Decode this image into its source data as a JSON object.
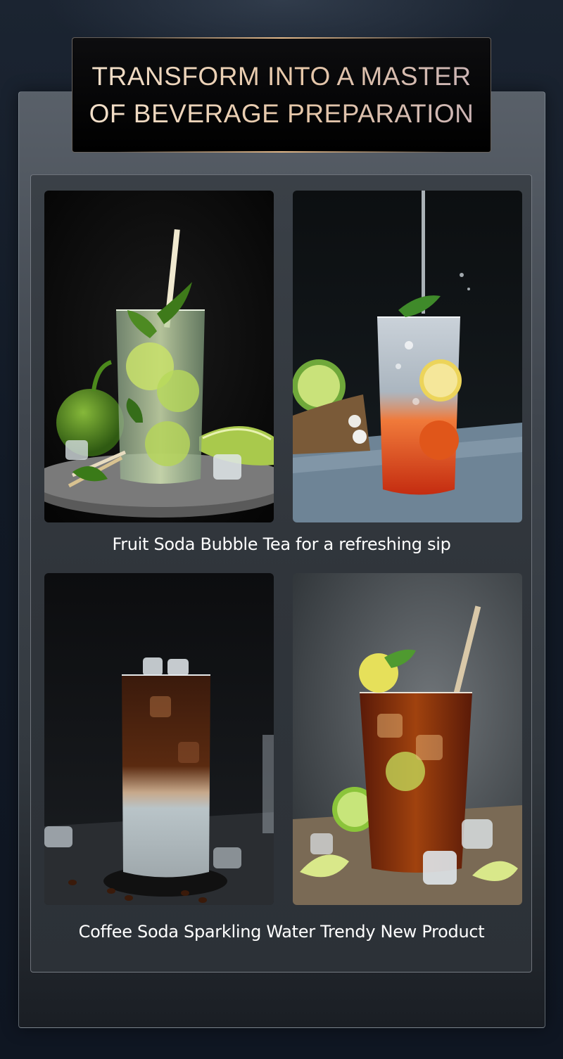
{
  "title": {
    "line1": "TRANSFORM INTO A MASTER",
    "line2": "OF BEVERAGE PREPARATION"
  },
  "rows": [
    {
      "caption": "Fruit Soda Bubble Tea for a refreshing sip",
      "images": [
        {
          "alt": "Mojito with lime, mint and straw"
        },
        {
          "alt": "Sparkling red fruit soda with lemon and mint"
        }
      ]
    },
    {
      "caption": "Coffee Soda Sparkling Water Trendy New Product",
      "images": [
        {
          "alt": "Layered coffee soda with ice"
        },
        {
          "alt": "Iced cola with lime and straw"
        }
      ]
    }
  ],
  "colors": {
    "title_gold": "#e6c7a8",
    "caption": "#ffffff",
    "panel": "#33393f",
    "background": "#131b27"
  }
}
